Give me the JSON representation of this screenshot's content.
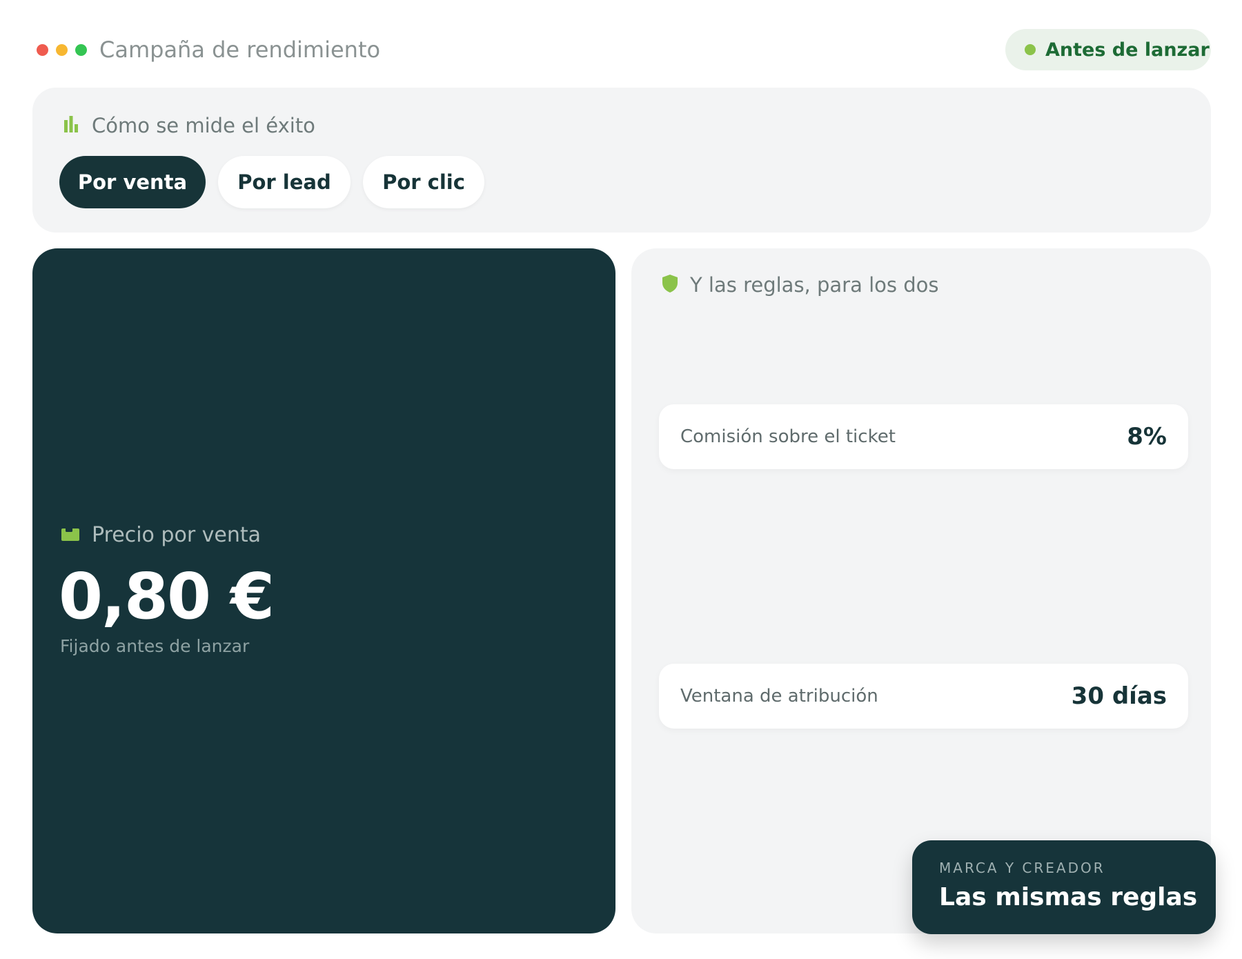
{
  "window": {
    "title": "Campaña de rendimiento",
    "controls": [
      {
        "name": "close",
        "color": "#ef5b4f"
      },
      {
        "name": "minimize",
        "color": "#f7b731"
      },
      {
        "name": "zoom",
        "color": "#34c553"
      }
    ]
  },
  "status": {
    "label": "Antes de lanzar",
    "color": "#8bc34a"
  },
  "metric_section": {
    "heading": "Cómo se mide el éxito",
    "icon": "bar-chart-icon",
    "tabs": [
      {
        "label": "Por venta",
        "active": true
      },
      {
        "label": "Por lead",
        "active": false
      },
      {
        "label": "Por clic",
        "active": false
      }
    ]
  },
  "price": {
    "icon": "banknote-icon",
    "label": "Precio por venta",
    "value": "0,80 €",
    "note": "Fijado antes de lanzar"
  },
  "rules": {
    "icon": "shield-icon",
    "heading": "Y las reglas, para los dos",
    "rows": [
      {
        "label": "Comisión sobre el ticket",
        "value": "8%"
      },
      {
        "label": "Ventana de atribución",
        "value": "30 días"
      }
    ]
  },
  "badge": {
    "eyebrow": "MARCA Y CREADOR",
    "headline": "Las mismas reglas"
  },
  "colors": {
    "accent_green": "#8bc34a",
    "dark_teal": "#16343a"
  }
}
